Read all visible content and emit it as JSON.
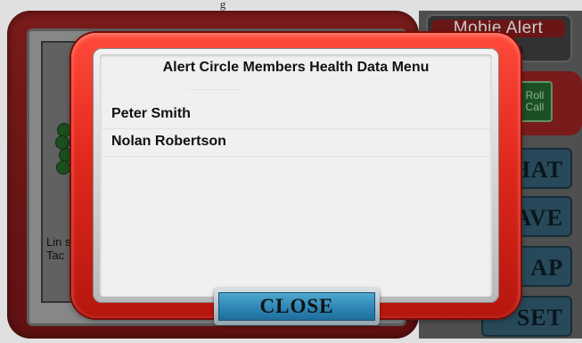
{
  "background": {
    "app_title": "Mobie Alert",
    "roll_call_label": "Roll Call",
    "side_buttons": [
      "HAT",
      "AVE",
      "AP",
      "SET"
    ],
    "left_text": "Lin situ Tac"
  },
  "modal": {
    "title": "Alert Circle Members Health Data Menu",
    "members": [
      {
        "name": "Peter Smith"
      },
      {
        "name": "Nolan Robertson"
      }
    ],
    "close_label": "CLOSE"
  },
  "colors": {
    "modal_frame": "#e0281c",
    "close_button": "#2e86b6",
    "panel": "#f0f0f0"
  }
}
